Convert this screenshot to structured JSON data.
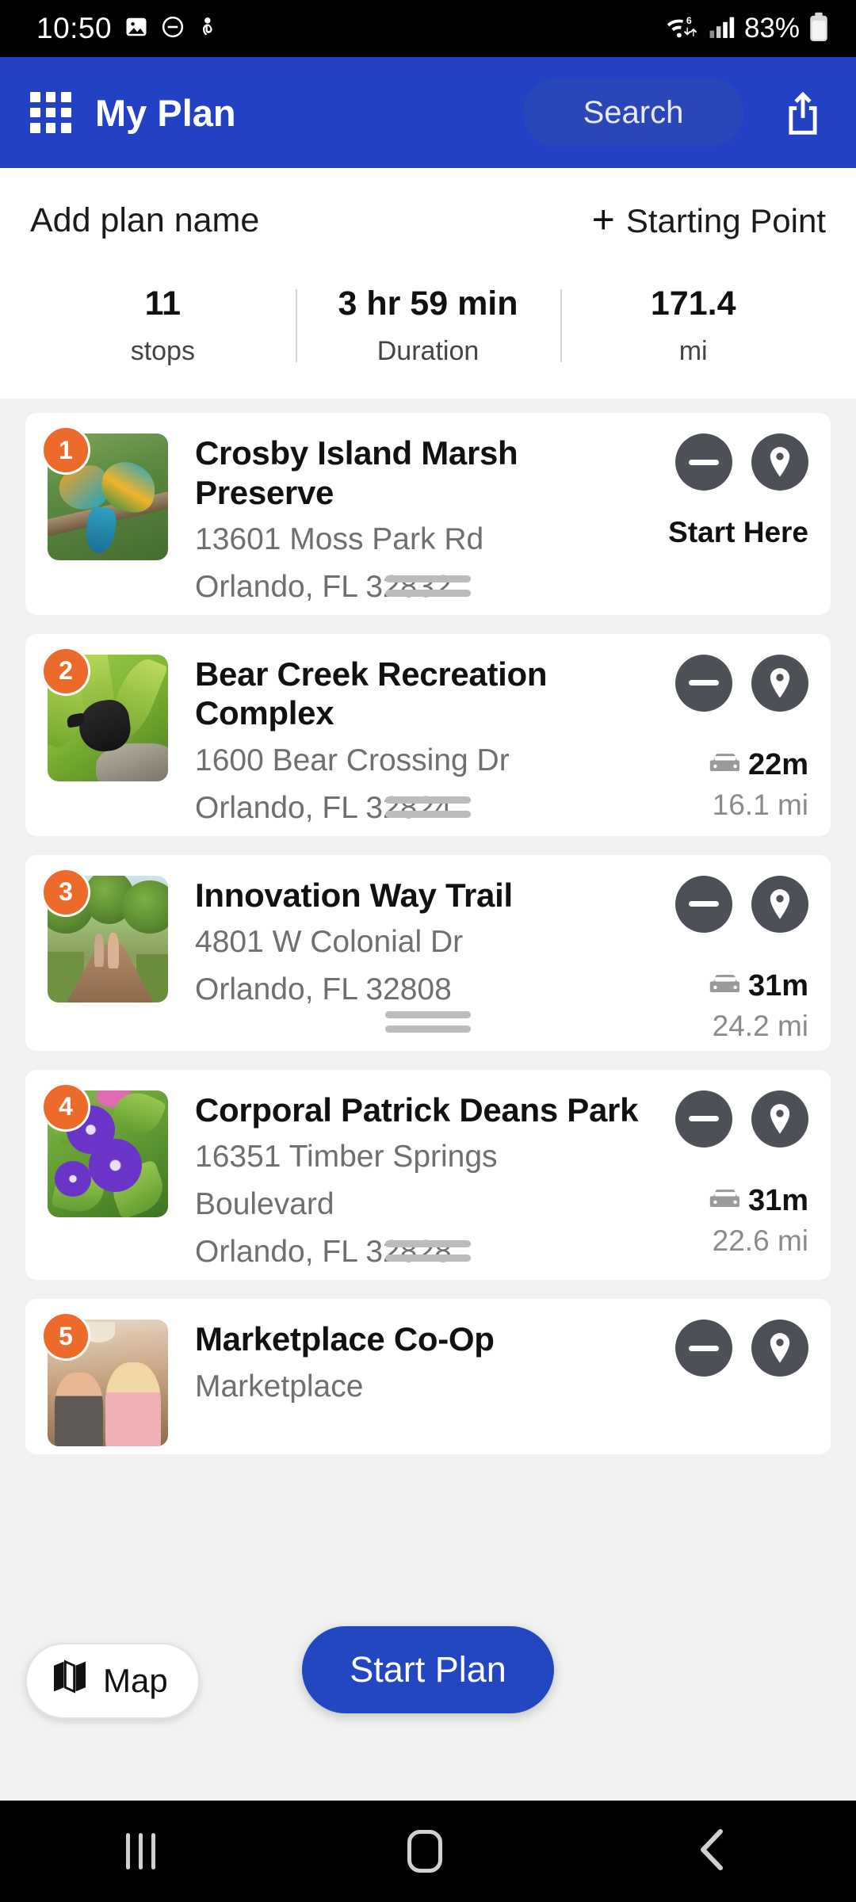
{
  "status_bar": {
    "time": "10:50",
    "battery_text": "83%",
    "left_icons": [
      "image-icon",
      "do-not-disturb-icon",
      "nfc-icon"
    ],
    "right_icons": [
      "wifi-6-icon",
      "cellular-signal-icon",
      "battery-icon"
    ]
  },
  "app_bar": {
    "menu_icon": "grid-menu-icon",
    "title": "My Plan",
    "search_label": "Search",
    "share_icon": "share-icon"
  },
  "plan_header": {
    "plan_name_placeholder": "Add plan name",
    "starting_point_label": "Starting Point",
    "add_icon": "plus-icon",
    "stats": [
      {
        "value": "11",
        "label": "stops"
      },
      {
        "value": "3 hr 59 min",
        "label": "Duration"
      },
      {
        "value": "171.4",
        "label": "mi"
      }
    ]
  },
  "stops": [
    {
      "number": "1",
      "title": "Crosby Island Marsh Preserve",
      "address_line1": "13601 Moss Park Rd",
      "address_line2": "Orlando, FL 32832",
      "status_label": "Start Here",
      "drive_time": "",
      "drive_distance": "",
      "thumb_alt": "two-bee-eater-birds-on-branch"
    },
    {
      "number": "2",
      "title": "Bear Creek Recreation Complex",
      "address_line1": "1600 Bear Crossing Dr",
      "address_line2": "Orlando, FL 32824",
      "status_label": "",
      "drive_time": "22m",
      "drive_distance": "16.1 mi",
      "thumb_alt": "dark-bird-among-green-leaves"
    },
    {
      "number": "3",
      "title": "Innovation Way Trail",
      "address_line1": "4801 W Colonial Dr",
      "address_line2": "Orlando, FL 32808",
      "status_label": "",
      "drive_time": "31m",
      "drive_distance": "24.2 mi",
      "thumb_alt": "tree-lined-walking-trail"
    },
    {
      "number": "4",
      "title": "Corporal Patrick Deans Park",
      "address_line1": "16351 Timber Springs",
      "address_line1b": "Boulevard",
      "address_line2": "Orlando, FL 32828",
      "status_label": "",
      "drive_time": "31m",
      "drive_distance": "22.6 mi",
      "thumb_alt": "purple-periwinkle-flowers"
    },
    {
      "number": "5",
      "title": "Marketplace Co-Op",
      "address_line1": "Marketplace",
      "address_line2": "",
      "status_label": "",
      "drive_time": "",
      "drive_distance": "",
      "thumb_alt": "two-people-at-marketplace"
    }
  ],
  "floating": {
    "map_label": "Map",
    "map_icon": "map-icon",
    "start_plan_label": "Start Plan"
  },
  "nav_bar": {
    "recents_icon": "recents-icon",
    "home_icon": "home-icon",
    "back_icon": "back-icon"
  },
  "colors": {
    "app_bar_blue": "#2341c4",
    "start_plan_blue": "#2347c0",
    "badge_orange": "#ed6b2a",
    "action_circle_gray": "#4d5157",
    "page_background": "#f1f1f1"
  }
}
